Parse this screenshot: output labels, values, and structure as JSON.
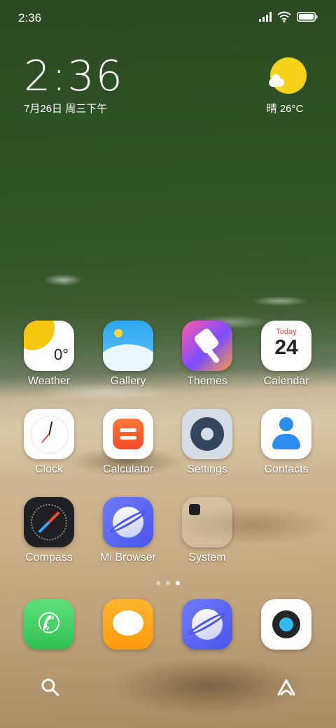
{
  "status_bar": {
    "time": "2:36",
    "icons": [
      "signal-icon",
      "wifi-icon",
      "battery-icon"
    ]
  },
  "clock_widget": {
    "time": "2:36",
    "date": "7月26日 周三下午"
  },
  "weather_widget": {
    "icon": "sun-cloud-icon",
    "text": "晴 26°C"
  },
  "apps": {
    "weather": {
      "label": "Weather",
      "icon_value": "0°"
    },
    "gallery": {
      "label": "Gallery"
    },
    "themes": {
      "label": "Themes"
    },
    "calendar": {
      "label": "Calendar",
      "month": "Today",
      "day": "24"
    },
    "clock": {
      "label": "Clock"
    },
    "calculator": {
      "label": "Calculator"
    },
    "settings": {
      "label": "Settings"
    },
    "contacts": {
      "label": "Contacts"
    },
    "compass": {
      "label": "Compass"
    },
    "browser": {
      "label": "Mi Browser"
    },
    "system": {
      "label": "System"
    }
  },
  "page_indicator": {
    "pages": 3,
    "active": 3
  },
  "dock": {
    "items": [
      {
        "name": "phone",
        "icon": "phone-icon"
      },
      {
        "name": "messages",
        "icon": "message-icon"
      },
      {
        "name": "browser",
        "icon": "browser-icon"
      },
      {
        "name": "camera",
        "icon": "camera-icon"
      }
    ]
  },
  "bottom_bar": {
    "left_icon": "search-icon",
    "right_icon": "assistant-icon"
  }
}
